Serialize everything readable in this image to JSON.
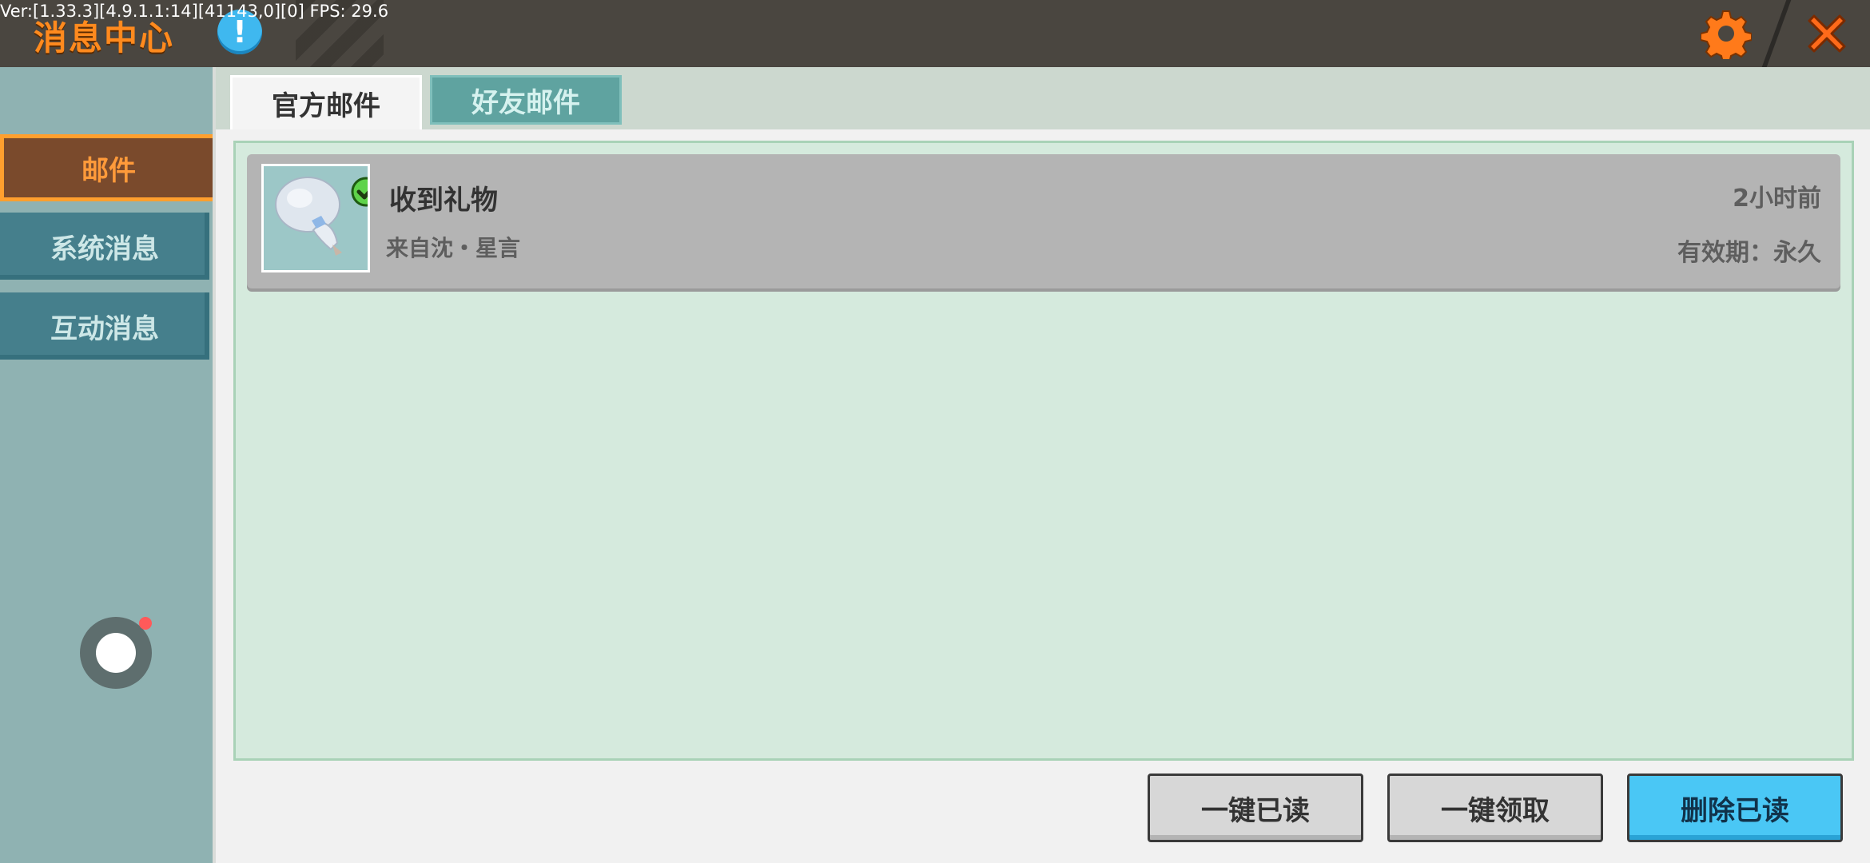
{
  "debug": {
    "text": "Ver:[1.33.3][4.9.1.1:14][41143,0][0] FPS: 29.6"
  },
  "header": {
    "title": "消息中心",
    "info_icon": "info-icon",
    "settings_icon": "gear-icon",
    "close_icon": "close-icon",
    "info_glyph": "!"
  },
  "sidebar": {
    "items": [
      {
        "label": "邮件",
        "active": true
      },
      {
        "label": "系统消息",
        "active": false
      },
      {
        "label": "互动消息",
        "active": false
      }
    ]
  },
  "tabs": [
    {
      "label": "官方邮件",
      "active": true
    },
    {
      "label": "好友邮件",
      "active": false
    }
  ],
  "mail_list": [
    {
      "title": "收到礼物",
      "sender": "来自沈・星言",
      "time": "2小时前",
      "validity": "有效期：永久",
      "icon": "gift-item-icon",
      "read": true
    }
  ],
  "actions": {
    "mark_all_read": "一键已读",
    "claim_all": "一键领取",
    "delete_read": "删除已读"
  },
  "colors": {
    "accent_orange": "#ff8a1e",
    "tab_inactive": "#5fa3a0",
    "list_bg": "#d5eadd",
    "delete_button": "#4ac7f5"
  }
}
